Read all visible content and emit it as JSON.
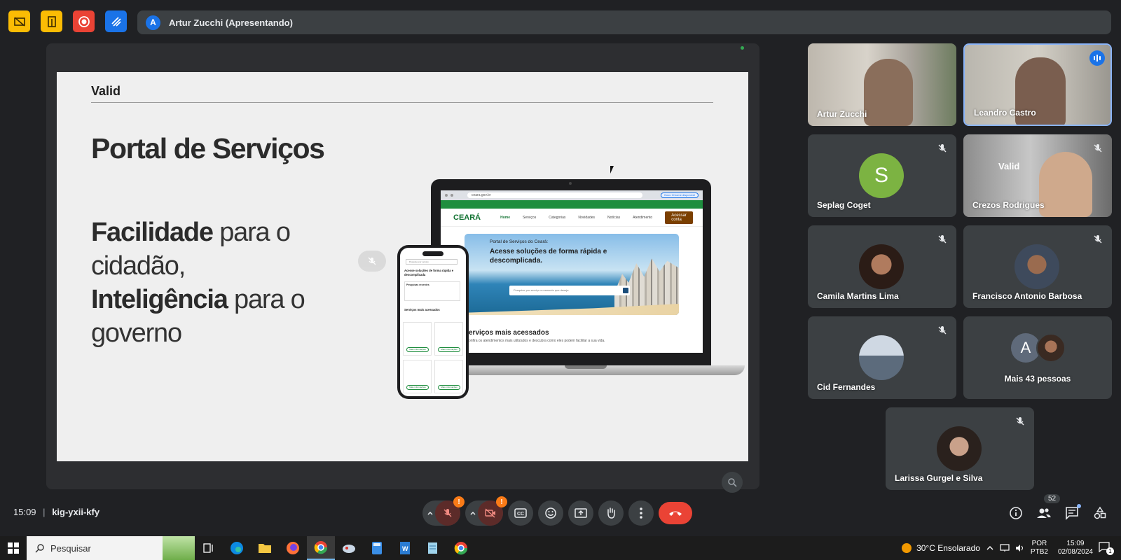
{
  "top": {
    "presenter_initial": "A",
    "presenter_label": "Artur Zucchi (Apresentando)"
  },
  "slide": {
    "brand": "Valid",
    "title": "Portal de Serviços",
    "body_bold_1": "Facilidade",
    "body_1": " para o cidadão,",
    "body_bold_2": "Inteligência",
    "body_2": " para o governo",
    "laptop": {
      "url": "ceara.gov.br",
      "chrome_button": "Novo Chrome disponível",
      "logo": "CEARÁ",
      "nav": [
        "Home",
        "Serviços",
        "Categorias",
        "Novidades",
        "Notícias",
        "Atendimento"
      ],
      "cta": "Acessar conta",
      "hero_small": "Portal de Serviços do Ceará:",
      "hero_big": "Acesse soluções de forma rápida e descomplicada.",
      "search_placeholder": "Pesquise por serviço ou assunto que deseja",
      "section_title": "erviços mais acessados",
      "section_sub": "onfira os atendimentos mais utilizados e descubra como eles podem facilitar a sua vida."
    },
    "phone": {
      "search_placeholder": "Pesquise por serviço",
      "heading": "Acesse soluções de forma rápida e descomplicada",
      "box_label": "Pesquisas recentes",
      "section": "Serviços mais acessados",
      "card_button": "Mais informações"
    }
  },
  "participants": [
    {
      "name": "Artur Zucchi",
      "muted": false
    },
    {
      "name": "Leandro Castro",
      "speaking": true
    },
    {
      "name": "Seplag Coget",
      "initial": "S",
      "muted": true
    },
    {
      "name": "Crezos Rodrigues",
      "muted": true
    },
    {
      "name": "Camila Martins Lima",
      "muted": true
    },
    {
      "name": "Francisco Antonio Barbosa",
      "muted": true
    },
    {
      "name": "Cid Fernandes",
      "muted": true
    },
    {
      "name": "Mais 43 pessoas",
      "initial": "A"
    },
    {
      "name": "Larissa Gurgel e Silva",
      "muted": true
    }
  ],
  "meeting": {
    "time": "15:09",
    "separator": "|",
    "code": "kig-yxii-kfy",
    "people_count": "52",
    "warn": "!"
  },
  "taskbar": {
    "search": "Pesquisar",
    "weather": "30°C  Ensolarado",
    "lang_1": "POR",
    "lang_2": "PTB2",
    "clock_time": "15:09",
    "clock_date": "02/08/2024",
    "notif": "1"
  },
  "colors": {
    "meet_bg": "#202124",
    "tile_bg": "#3c4043",
    "hangup": "#ea4335",
    "accent": "#8ab4f8",
    "seplag_avatar": "#7cb342"
  }
}
